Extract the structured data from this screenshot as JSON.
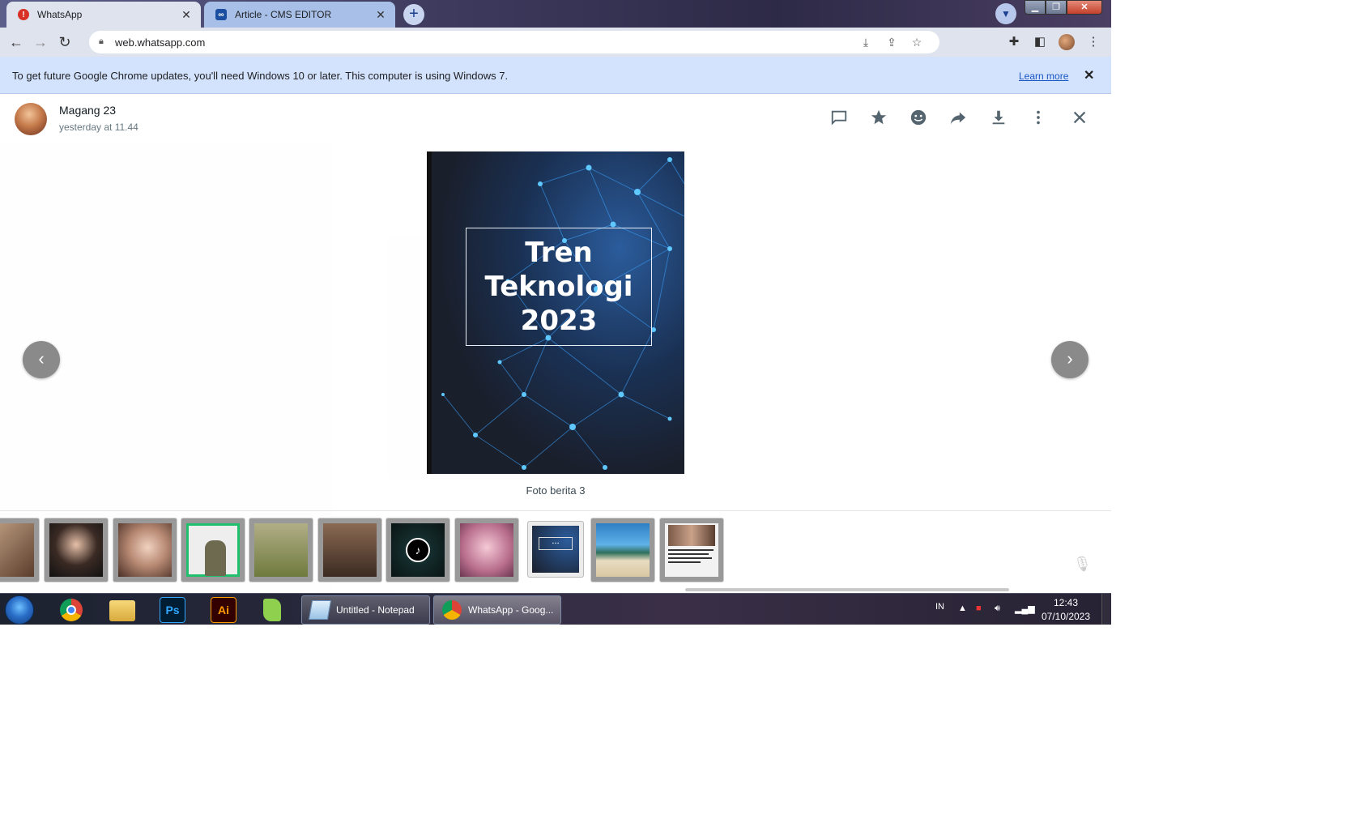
{
  "browser": {
    "tabs": [
      {
        "title": "WhatsApp",
        "favicon": "alert-icon"
      },
      {
        "title": "Article - CMS EDITOR",
        "favicon": "cms-icon"
      }
    ],
    "url": "web.whatsapp.com",
    "infobar": {
      "text": "To get future Google Chrome updates, you'll need Windows 10 or later. This computer is using Windows 7.",
      "link": "Learn more"
    }
  },
  "viewer": {
    "sender_name": "Magang 23",
    "timestamp": "yesterday at 11.44",
    "media_title_lines": [
      "Tren",
      "Teknologi",
      "2023"
    ],
    "caption": "Foto berita 3",
    "header_icons": [
      "reply-icon",
      "star-icon",
      "emoji-icon",
      "forward-icon",
      "download-icon",
      "menu-icon",
      "close-icon"
    ]
  },
  "taskbar": {
    "windows": [
      {
        "title": "Untitled - Notepad"
      },
      {
        "title": "WhatsApp - Goog..."
      }
    ],
    "language": "IN",
    "time": "12:43",
    "date": "07/10/2023"
  },
  "colors": {
    "infobar_bg": "#d3e3fd",
    "link": "#1a56c4",
    "media_bg": "#1a2130",
    "network_blue": "#3aa3ff"
  }
}
